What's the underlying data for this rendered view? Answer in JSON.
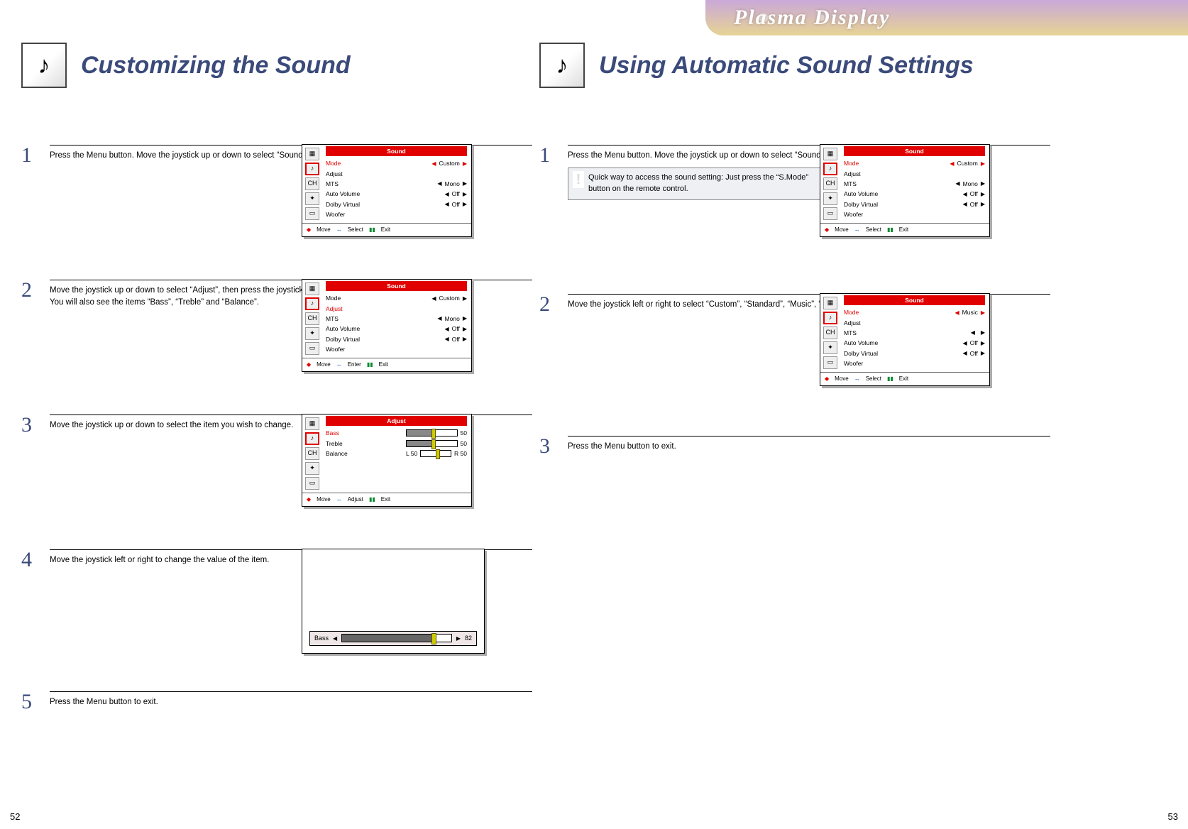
{
  "brand": "Plasma Display",
  "page_left_num": "52",
  "page_right_num": "53",
  "left": {
    "title": "Customizing the Sound",
    "steps": [
      {
        "n": "1",
        "text": "Press the Menu button. Move the joystick up or down to select “Sound”, then press the joystick to enter."
      },
      {
        "n": "2",
        "text": "Move the joystick up or down to select “Adjust”, then press the joystick to enter.\nYou will also see the items “Bass”, “Treble” and “Balance”."
      },
      {
        "n": "3",
        "text": "Move the joystick up or down to select the item you wish to change."
      },
      {
        "n": "4",
        "text": "Move the joystick left or right to change the value of the item."
      },
      {
        "n": "5",
        "text": "Press the Menu button to exit."
      }
    ],
    "osd1": {
      "title": "Sound",
      "rows": [
        {
          "label": "Mode",
          "val": "Custom",
          "hl": true,
          "arrows": true
        },
        {
          "label": "Adjust",
          "val": ""
        },
        {
          "label": "MTS",
          "val": "Mono",
          "arrows": true
        },
        {
          "label": "Auto Volume",
          "val": "Off",
          "arrows": true
        },
        {
          "label": "Dolby Virtual",
          "val": "Off",
          "arrows": true
        },
        {
          "label": "Woofer",
          "val": ""
        }
      ],
      "foot": {
        "move": "Move",
        "mid": "Select",
        "exit": "Exit"
      }
    },
    "osd2": {
      "title": "Sound",
      "rows": [
        {
          "label": "Mode",
          "val": "Custom",
          "arrows": true
        },
        {
          "label": "Adjust",
          "val": "",
          "hl": true
        },
        {
          "label": "MTS",
          "val": "Mono",
          "arrows": true
        },
        {
          "label": "Auto Volume",
          "val": "Off",
          "arrows": true
        },
        {
          "label": "Dolby Virtual",
          "val": "Off",
          "arrows": true
        },
        {
          "label": "Woofer",
          "val": ""
        }
      ],
      "foot": {
        "move": "Move",
        "mid": "Enter",
        "exit": "Exit"
      }
    },
    "osd3": {
      "title": "Adjust",
      "rows": [
        {
          "label": "Bass",
          "slider": 50,
          "hl": true
        },
        {
          "label": "Treble",
          "slider": 50
        },
        {
          "label": "Balance",
          "balance": {
            "l": "L 50",
            "r": "R 50",
            "pos": 50
          }
        }
      ],
      "foot": {
        "move": "Move",
        "mid": "Adjust",
        "exit": "Exit"
      }
    },
    "bass": {
      "label": "Bass",
      "value": 82
    }
  },
  "right": {
    "title": "Using Automatic Sound Settings",
    "steps": [
      {
        "n": "1",
        "text": "Press the Menu button. Move the joystick up or down to select “Sound”, then press the joystick to enter.",
        "tip": "Quick way to access the sound setting: Just press the “S.Mode” button on the remote control."
      },
      {
        "n": "2",
        "text": "Move the joystick left or right to select “Custom”, “Standard”, “Music”, “Movie” or “Speech” sound setting."
      },
      {
        "n": "3",
        "text": "Press the Menu button to exit."
      }
    ],
    "osd1": {
      "title": "Sound",
      "rows": [
        {
          "label": "Mode",
          "val": "Custom",
          "hl": true,
          "arrows": true
        },
        {
          "label": "Adjust",
          "val": ""
        },
        {
          "label": "MTS",
          "val": "Mono",
          "arrows": true
        },
        {
          "label": "Auto Volume",
          "val": "Off",
          "arrows": true
        },
        {
          "label": "Dolby Virtual",
          "val": "Off",
          "arrows": true
        },
        {
          "label": "Woofer",
          "val": ""
        }
      ],
      "foot": {
        "move": "Move",
        "mid": "Select",
        "exit": "Exit"
      }
    },
    "osd2": {
      "title": "Sound",
      "rows": [
        {
          "label": "Mode",
          "val": "Music",
          "hl": true,
          "arrows": true
        },
        {
          "label": "Adjust",
          "val": ""
        },
        {
          "label": "MTS",
          "val": "",
          "arrows": true
        },
        {
          "label": "Auto Volume",
          "val": "Off",
          "arrows": true
        },
        {
          "label": "Dolby Virtual",
          "val": "Off",
          "arrows": true
        },
        {
          "label": "Woofer",
          "val": ""
        }
      ],
      "foot": {
        "move": "Move",
        "mid": "Select",
        "exit": "Exit"
      }
    }
  },
  "icons": {
    "picture": "▦",
    "sound": "♪",
    "ch": "CH",
    "feat": "✦",
    "setup": "▭"
  }
}
